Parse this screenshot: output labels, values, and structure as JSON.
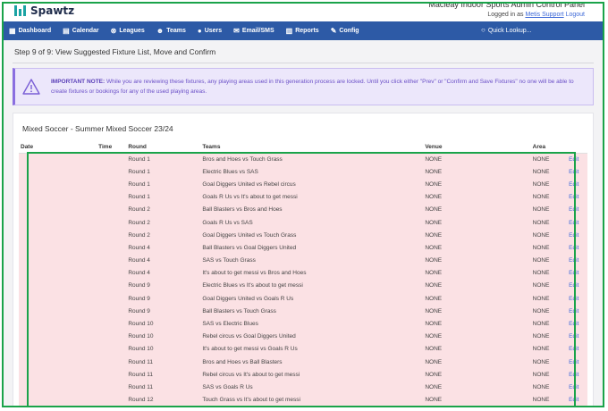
{
  "brand": {
    "name": "Spawtz"
  },
  "header": {
    "app_title": "Macleay Indoor Sports Admin Control Panel",
    "logged_in_prefix": "Logged in as",
    "user": "Metis Support",
    "logout": "Logout"
  },
  "nav": {
    "items": [
      {
        "label": "Dashboard",
        "icon": "dashboard-icon"
      },
      {
        "label": "Calendar",
        "icon": "calendar-icon"
      },
      {
        "label": "Leagues",
        "icon": "leagues-icon"
      },
      {
        "label": "Teams",
        "icon": "teams-icon"
      },
      {
        "label": "Users",
        "icon": "user-icon"
      },
      {
        "label": "Email/SMS",
        "icon": "envelope-icon"
      },
      {
        "label": "Reports",
        "icon": "chart-icon"
      },
      {
        "label": "Config",
        "icon": "wrench-icon"
      }
    ],
    "quick_lookup": "Quick Lookup..."
  },
  "page": {
    "step_title": "Step 9 of 9: View Suggested Fixture List, Move and Confirm",
    "notice_label": "IMPORTANT NOTE:",
    "notice_text": " While you are reviewing these fixtures, any playing areas used in this generation process are locked. Until you click either \"Prev\" or \"Confirm and Save Fixtures\" no one will be able to create fixtures or bookings for any of the used playing areas.",
    "colors": {
      "accent": "#2d5aa6",
      "notice_bg": "#ece7fb",
      "row_bg": "#fbe1e4",
      "link": "#3f6ad8"
    }
  },
  "fixtures": {
    "title": "Mixed Soccer - Summer Mixed Soccer 23/24",
    "columns": [
      "Date",
      "Time",
      "Round",
      "Teams",
      "Venue",
      "Area",
      ""
    ],
    "edit_label": "Edit",
    "rows": [
      {
        "date": "",
        "time": "",
        "round": "Round 1",
        "teams": "Bros and Hoes vs Touch Grass",
        "venue": "NONE",
        "area": "NONE"
      },
      {
        "date": "",
        "time": "",
        "round": "Round 1",
        "teams": "Electric Blues vs SAS",
        "venue": "NONE",
        "area": "NONE"
      },
      {
        "date": "",
        "time": "",
        "round": "Round 1",
        "teams": "Goal Diggers United vs Rebel circus",
        "venue": "NONE",
        "area": "NONE"
      },
      {
        "date": "",
        "time": "",
        "round": "Round 1",
        "teams": "Goals R Us vs It's about to get messi",
        "venue": "NONE",
        "area": "NONE"
      },
      {
        "date": "",
        "time": "",
        "round": "Round 2",
        "teams": "Ball Blasters vs Bros and Hoes",
        "venue": "NONE",
        "area": "NONE"
      },
      {
        "date": "",
        "time": "",
        "round": "Round 2",
        "teams": "Goals R Us vs SAS",
        "venue": "NONE",
        "area": "NONE"
      },
      {
        "date": "",
        "time": "",
        "round": "Round 2",
        "teams": "Goal Diggers United vs Touch Grass",
        "venue": "NONE",
        "area": "NONE"
      },
      {
        "date": "",
        "time": "",
        "round": "Round 4",
        "teams": "Ball Blasters vs Goal Diggers United",
        "venue": "NONE",
        "area": "NONE"
      },
      {
        "date": "",
        "time": "",
        "round": "Round 4",
        "teams": "SAS vs Touch Grass",
        "venue": "NONE",
        "area": "NONE"
      },
      {
        "date": "",
        "time": "",
        "round": "Round 4",
        "teams": "It's about to get messi vs Bros and Hoes",
        "venue": "NONE",
        "area": "NONE"
      },
      {
        "date": "",
        "time": "",
        "round": "Round 9",
        "teams": "Electric Blues vs It's about to get messi",
        "venue": "NONE",
        "area": "NONE"
      },
      {
        "date": "",
        "time": "",
        "round": "Round 9",
        "teams": "Goal Diggers United vs Goals R Us",
        "venue": "NONE",
        "area": "NONE"
      },
      {
        "date": "",
        "time": "",
        "round": "Round 9",
        "teams": "Ball Blasters vs Touch Grass",
        "venue": "NONE",
        "area": "NONE"
      },
      {
        "date": "",
        "time": "",
        "round": "Round 10",
        "teams": "SAS vs Electric Blues",
        "venue": "NONE",
        "area": "NONE"
      },
      {
        "date": "",
        "time": "",
        "round": "Round 10",
        "teams": "Rebel circus vs Goal Diggers United",
        "venue": "NONE",
        "area": "NONE"
      },
      {
        "date": "",
        "time": "",
        "round": "Round 10",
        "teams": "It's about to get messi vs Goals R Us",
        "venue": "NONE",
        "area": "NONE"
      },
      {
        "date": "",
        "time": "",
        "round": "Round 11",
        "teams": "Bros and Hoes vs Ball Blasters",
        "venue": "NONE",
        "area": "NONE"
      },
      {
        "date": "",
        "time": "",
        "round": "Round 11",
        "teams": "Rebel circus vs It's about to get messi",
        "venue": "NONE",
        "area": "NONE"
      },
      {
        "date": "",
        "time": "",
        "round": "Round 11",
        "teams": "SAS vs Goals R Us",
        "venue": "NONE",
        "area": "NONE"
      },
      {
        "date": "",
        "time": "",
        "round": "Round 12",
        "teams": "Touch Grass vs It's about to get messi",
        "venue": "NONE",
        "area": "NONE"
      }
    ]
  }
}
